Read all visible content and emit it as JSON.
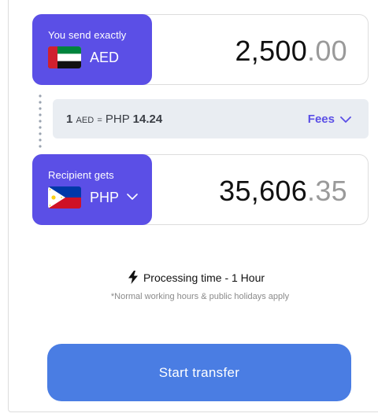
{
  "send": {
    "caption": "You send exactly",
    "currency": "AED",
    "flag_icon": "uae-flag-icon",
    "amount_int": "2,500",
    "amount_dec": ".00"
  },
  "rate": {
    "base_amount": "1",
    "base_currency": "AED",
    "equals": "=",
    "quote_currency": "PHP",
    "quote_rate": "14.24",
    "fees_label": "Fees"
  },
  "receive": {
    "caption": "Recipient gets",
    "currency": "PHP",
    "flag_icon": "philippines-flag-icon",
    "amount_int": "35,606",
    "amount_dec": ".35"
  },
  "processing": {
    "label": "Processing time - 1 Hour",
    "note": "*Normal working hours & public holidays apply"
  },
  "actions": {
    "start_label": "Start transfer"
  },
  "colors": {
    "accent": "#5b4fe6",
    "button": "#4a7de3",
    "rate_bg": "#e9edf2"
  }
}
